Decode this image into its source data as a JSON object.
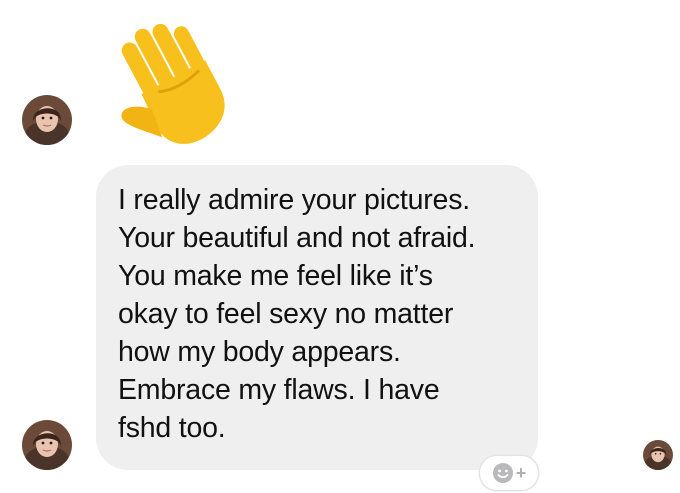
{
  "thread": {
    "messages": [
      {
        "type": "emoji",
        "emoji_name": "waving-hand-icon"
      },
      {
        "type": "text",
        "text": "I really admire your pictures.\nYour beautiful and not afraid.\nYou make me feel like it’s\nokay to feel sexy no matter\nhow my body appears.\nEmbrace my flaws. I have\nfshd too."
      }
    ],
    "react_button": {
      "icon": "smiley-icon",
      "plus": "+"
    }
  },
  "colors": {
    "bubble_background": "#efeff0",
    "text": "#111111",
    "emoji_yellow": "#f7c01c"
  }
}
